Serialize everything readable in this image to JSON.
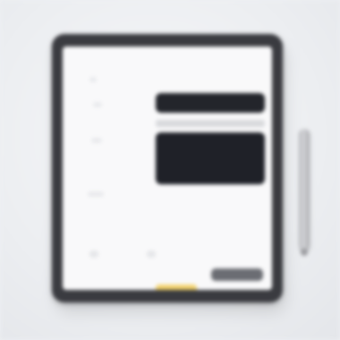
{
  "scene": {
    "description_label": "",
    "colors": {
      "background": "#eef0f3",
      "device_frame": "#3a3b40",
      "screen": "#f9f9fa",
      "dark_card": "#1f2128",
      "accent": "#f4d36b",
      "stylus": "#c5c6c9"
    }
  },
  "icons": {
    "stylus": "stylus-icon"
  }
}
